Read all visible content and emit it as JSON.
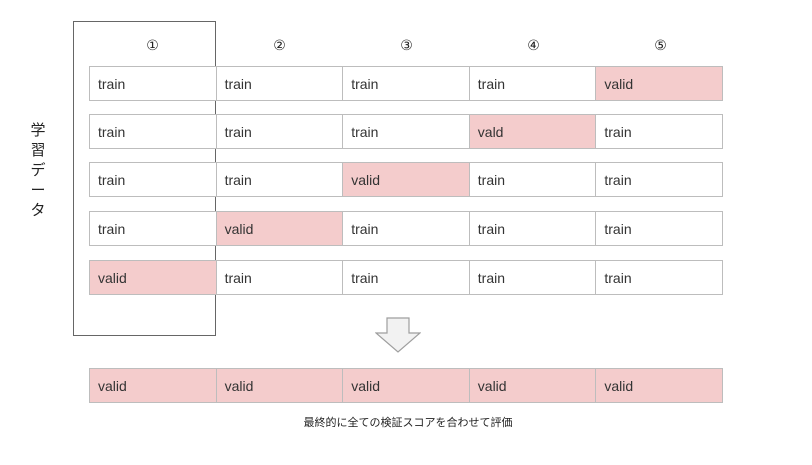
{
  "side_label": [
    "学",
    "習",
    "デ",
    "ー",
    "タ"
  ],
  "fold_headers": [
    "①",
    "②",
    "③",
    "④",
    "⑤"
  ],
  "rows": [
    [
      "train",
      "train",
      "train",
      "train",
      "valid"
    ],
    [
      "train",
      "train",
      "train",
      "vald",
      "train"
    ],
    [
      "train",
      "train",
      "valid",
      "train",
      "train"
    ],
    [
      "train",
      "valid",
      "train",
      "train",
      "train"
    ],
    [
      "valid",
      "train",
      "train",
      "train",
      "train"
    ]
  ],
  "result_row": [
    "valid",
    "valid",
    "valid",
    "valid",
    "valid"
  ],
  "caption": "最終的に全ての検証スコアを合わせて評価",
  "colors": {
    "valid_fill": "#f4cccc",
    "train_fill": "#ffffff",
    "cell_border": "#bdbdbd",
    "arrow_fill": "#f2f2f2",
    "arrow_stroke": "#9e9e9e"
  }
}
